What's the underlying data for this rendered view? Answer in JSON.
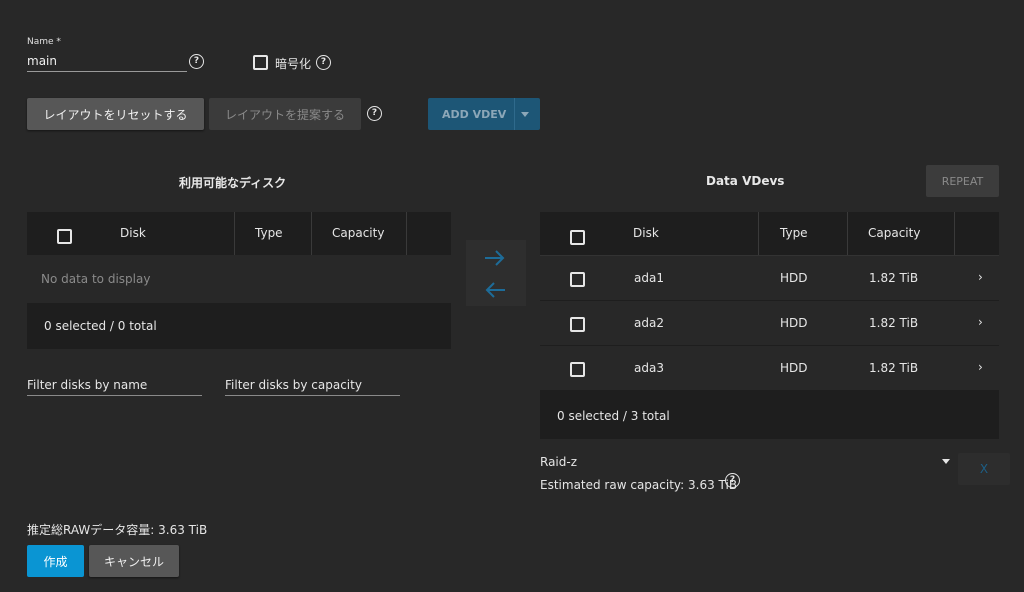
{
  "form": {
    "name_label": "Name *",
    "name_value": "main",
    "encrypt_label": "暗号化"
  },
  "toolbar": {
    "reset_label": "レイアウトをリセットする",
    "suggest_label": "レイアウトを提案する",
    "add_vdev_label": "ADD VDEV"
  },
  "available": {
    "title": "利用可能なディスク",
    "columns": [
      "Disk",
      "Type",
      "Capacity"
    ],
    "empty_text": "No data to display",
    "footer": "0 selected / 0 total",
    "filter_name_placeholder": "Filter disks by name",
    "filter_capacity_placeholder": "Filter disks by capacity"
  },
  "vdevs": {
    "title": "Data VDevs",
    "repeat_label": "REPEAT",
    "columns": [
      "Disk",
      "Type",
      "Capacity"
    ],
    "rows": [
      {
        "disk": "ada1",
        "type": "HDD",
        "capacity": "1.82 TiB",
        "chevron": "›"
      },
      {
        "disk": "ada2",
        "type": "HDD",
        "capacity": "1.82 TiB",
        "chevron": "›"
      },
      {
        "disk": "ada3",
        "type": "HDD",
        "capacity": "1.82 TiB",
        "chevron": "›"
      }
    ],
    "footer": "0 selected / 3 total",
    "raid_type": "Raid-z",
    "remove_label": "X",
    "estimated_capacity": "Estimated raw capacity: 3.63 TiB"
  },
  "summary": {
    "total_raw": "推定総RAWデータ容量: 3.63 TiB",
    "create_label": "作成",
    "cancel_label": "キャンセル"
  },
  "icons": {
    "help": "help-circle-icon",
    "checkbox": "checkbox-icon",
    "arrow_right": "arrow-right-icon",
    "arrow_left": "arrow-left-icon",
    "chevron": "chevron-right-icon",
    "caret": "caret-down-icon"
  },
  "colors": {
    "background": "#282828",
    "table": "#1e1e1e",
    "primary": "#0a95d3",
    "add_vdev": "#1d5676"
  }
}
